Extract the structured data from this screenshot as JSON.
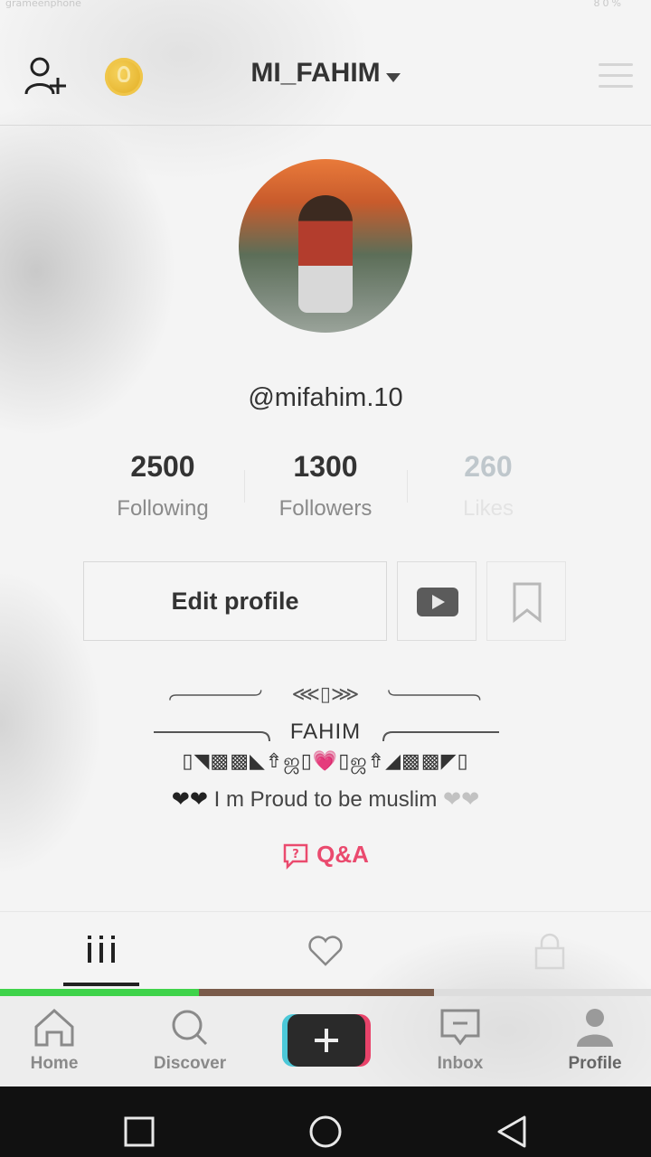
{
  "status_bar": {
    "left": "grameenphone",
    "right": "80%"
  },
  "header": {
    "title": "MI_FAHIM"
  },
  "profile": {
    "username": "@mifahim.10",
    "stats": [
      {
        "value": "2500",
        "label": "Following"
      },
      {
        "value": "1300",
        "label": "Followers"
      },
      {
        "value": "260",
        "label": "Likes"
      }
    ],
    "edit_button": "Edit profile"
  },
  "bio": {
    "symbol_top": "⋘▯⋙",
    "name": "FAHIM",
    "decor_line": "▯◥▩▩◣⇮ஜ▯💗▯ஜ⇮◢▩▩◤▯",
    "tagline_prefix": "❤❤",
    "tagline_text": " I m Proud to be muslim ",
    "tagline_suffix": "❤❤"
  },
  "qa": {
    "label": "Q&A"
  },
  "bottom_nav": {
    "home": "Home",
    "discover": "Discover",
    "inbox": "Inbox",
    "profile": "Profile"
  },
  "colors": {
    "accent": "#ea4a6e",
    "create_cyan": "#4cc8d8",
    "create_pink": "#e8436a"
  },
  "icons": [
    "add-user-icon",
    "coin-icon",
    "menu-icon",
    "youtube-icon",
    "bookmark-icon",
    "qa-icon",
    "grid-icon",
    "heart-icon",
    "lock-icon",
    "home-icon",
    "search-icon",
    "plus-icon",
    "inbox-icon",
    "profile-icon",
    "square-icon",
    "circle-icon",
    "back-icon"
  ]
}
